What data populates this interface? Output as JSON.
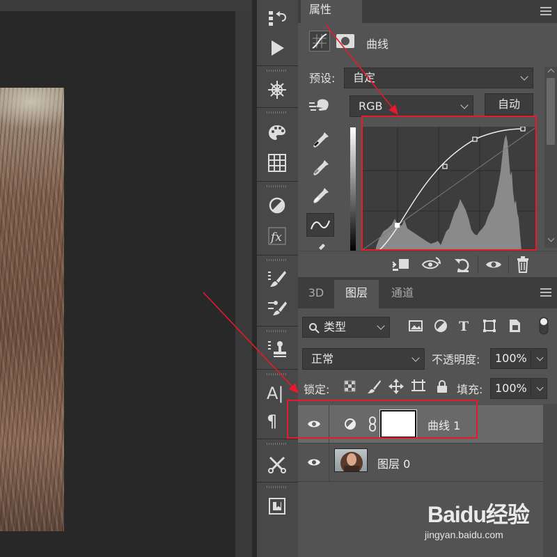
{
  "properties_panel": {
    "tab_label": "属性",
    "title": "曲线",
    "preset_label": "预设:",
    "preset_value": "自定",
    "channel_value": "RGB",
    "auto_button": "自动"
  },
  "layers_panel": {
    "tabs": [
      "3D",
      "图层",
      "通道"
    ],
    "active_tab": "图层",
    "filter_value": "类型",
    "blend_mode": "正常",
    "opacity_label": "不透明度:",
    "opacity_value": "100%",
    "lock_label": "锁定:",
    "fill_label": "填充:",
    "fill_value": "100%",
    "layers": [
      {
        "name": "曲线 1",
        "kind": "curves-adjustment",
        "selected": true,
        "visible": true
      },
      {
        "name": "图层 0",
        "kind": "image",
        "selected": false,
        "visible": true
      }
    ]
  },
  "toolbar": {
    "text_tool_glyph": "A|",
    "paragraph_glyph": "¶"
  },
  "watermark": {
    "logo": "Baidu经验",
    "url": "jingyan.baidu.com"
  },
  "colors": {
    "annotation_red": "#e8192c",
    "panel_bg": "#535353",
    "selected_row": "#696969"
  }
}
